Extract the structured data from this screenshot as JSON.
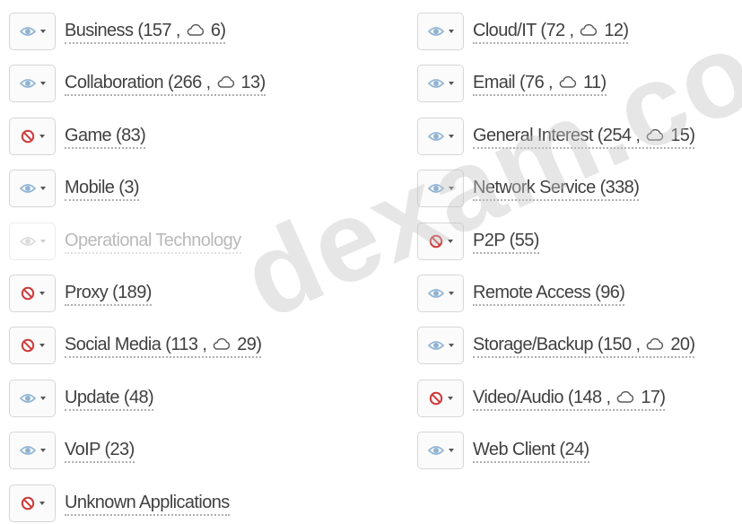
{
  "colors": {
    "monitor_icon": "#8fb3d3",
    "block_icon": "#cf3a3a",
    "text": "#404040",
    "disabled_text": "#b9b9b9",
    "watermark": "#c3c3c3"
  },
  "watermark": {
    "text": "dexam.com"
  },
  "categories": {
    "left": [
      {
        "name": "Business",
        "count": "157",
        "cloud": "6",
        "action": "monitor",
        "enabled": true
      },
      {
        "name": "Collaboration",
        "count": "266",
        "cloud": "13",
        "action": "monitor",
        "enabled": true
      },
      {
        "name": "Game",
        "count": "83",
        "cloud": "",
        "action": "block",
        "enabled": true
      },
      {
        "name": "Mobile",
        "count": "3",
        "cloud": "",
        "action": "monitor",
        "enabled": true
      },
      {
        "name": "Operational Technology",
        "count": "",
        "cloud": "",
        "action": "monitor",
        "enabled": false
      },
      {
        "name": "Proxy",
        "count": "189",
        "cloud": "",
        "action": "block",
        "enabled": true
      },
      {
        "name": "Social Media",
        "count": "113",
        "cloud": "29",
        "action": "block",
        "enabled": true
      },
      {
        "name": "Update",
        "count": "48",
        "cloud": "",
        "action": "monitor",
        "enabled": true
      },
      {
        "name": "VoIP",
        "count": "23",
        "cloud": "",
        "action": "monitor",
        "enabled": true
      },
      {
        "name": "Unknown Applications",
        "count": "",
        "cloud": "",
        "action": "block",
        "enabled": true
      }
    ],
    "right": [
      {
        "name": "Cloud/IT",
        "count": "72",
        "cloud": "12",
        "action": "monitor",
        "enabled": true
      },
      {
        "name": "Email",
        "count": "76",
        "cloud": "11",
        "action": "monitor",
        "enabled": true
      },
      {
        "name": "General Interest",
        "count": "254",
        "cloud": "15",
        "action": "monitor",
        "enabled": true
      },
      {
        "name": "Network Service",
        "count": "338",
        "cloud": "",
        "action": "monitor",
        "enabled": true
      },
      {
        "name": "P2P",
        "count": "55",
        "cloud": "",
        "action": "block",
        "enabled": true
      },
      {
        "name": "Remote Access",
        "count": "96",
        "cloud": "",
        "action": "monitor",
        "enabled": true
      },
      {
        "name": "Storage/Backup",
        "count": "150",
        "cloud": "20",
        "action": "monitor",
        "enabled": true
      },
      {
        "name": "Video/Audio",
        "count": "148",
        "cloud": "17",
        "action": "block",
        "enabled": true
      },
      {
        "name": "Web Client",
        "count": "24",
        "cloud": "",
        "action": "monitor",
        "enabled": true
      }
    ]
  }
}
